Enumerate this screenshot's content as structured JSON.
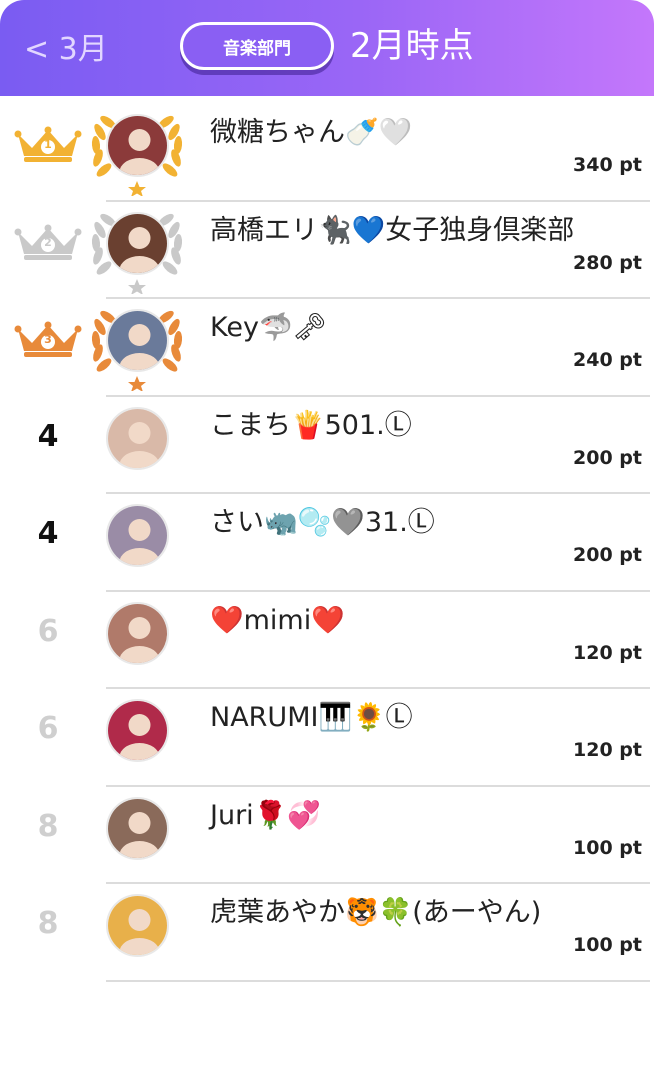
{
  "header": {
    "back_label": "< 3月",
    "department_label": "音楽部門",
    "period_title": "2月時点"
  },
  "colors": {
    "header_gradient_start": "#7a5cf2",
    "header_gradient_end": "#c477fb",
    "gold": "#f2b233",
    "silver": "#c9c9c9",
    "bronze": "#e88a3a"
  },
  "rankings": [
    {
      "rank": "1",
      "medal": "gold",
      "name": "微糖ちゃん🍼🤍",
      "points": "340 pt",
      "avatar_color": "#8b3a3a"
    },
    {
      "rank": "2",
      "medal": "silver",
      "name": "高橋エリ🐈‍⬛💙女子独身倶楽部",
      "points": "280 pt",
      "avatar_color": "#6a4030"
    },
    {
      "rank": "3",
      "medal": "bronze",
      "name": "Key🦈🗝",
      "points": "240 pt",
      "avatar_color": "#6a7a9a"
    },
    {
      "rank": "4",
      "medal": "",
      "name": "こまち🍟501.Ⓛ",
      "points": "200 pt",
      "avatar_color": "#d9b9a8"
    },
    {
      "rank": "4",
      "medal": "",
      "name": "さい🦏🫧🩶31.Ⓛ",
      "points": "200 pt",
      "avatar_color": "#9a8ca6"
    },
    {
      "rank": "6",
      "medal": "",
      "name": "❤️mimi❤️",
      "points": "120 pt",
      "avatar_color": "#b07a6a"
    },
    {
      "rank": "6",
      "medal": "",
      "name": "NARUMI🎹🌻Ⓛ",
      "points": "120 pt",
      "avatar_color": "#b02a4a"
    },
    {
      "rank": "8",
      "medal": "",
      "name": "Juri🌹💞",
      "points": "100 pt",
      "avatar_color": "#8a6a5a"
    },
    {
      "rank": "8",
      "medal": "",
      "name": "虎葉あやか🐯🍀(あーやん)",
      "points": "100 pt",
      "avatar_color": "#e8b04a"
    }
  ]
}
